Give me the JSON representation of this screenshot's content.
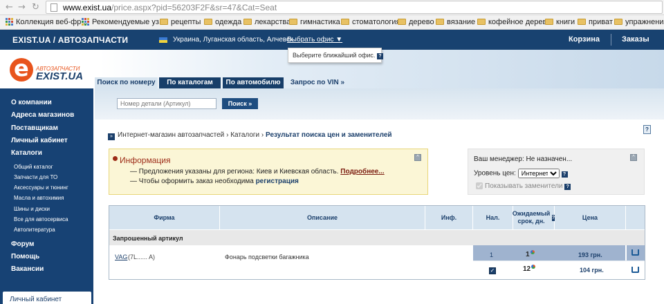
{
  "browser": {
    "url_host": "www.exist.ua",
    "url_path": "/price.aspx?pid=56203F2F&sr=47&Cat=Seat",
    "back": "←",
    "fwd": "→",
    "reload": "↻"
  },
  "bookmarks": [
    "Коллекция веб-фр...",
    "Рекомендуемые уз...",
    "рецепты",
    "одежда",
    "лекарства",
    "гимнастика",
    "стоматология",
    "дерево",
    "вязание",
    "кофейное дерево",
    "книги",
    "приват",
    "упражнения"
  ],
  "topbar": {
    "brand": "EXIST.UA / АВТОЗАПЧАСТИ",
    "region": "Украина, Луганская область, Алчевск",
    "office": "Выбрать офис ▼",
    "cart": "Корзина",
    "orders": "Заказы"
  },
  "tooltip": {
    "text": "Выберите ближайший офис.",
    "help": "?"
  },
  "logo": {
    "sub": "АВТОЗАПЧАСТИ",
    "name": "EXIST.UA"
  },
  "tabs": [
    "Поиск по номеру",
    "По каталогам",
    "По автомобилю",
    "Запрос по VIN »"
  ],
  "search": {
    "placeholder": "Номер детали (Артикул)",
    "button": "Поиск »"
  },
  "sidebar": {
    "main": [
      "О компании",
      "Адреса магазинов",
      "Поставщикам",
      "Личный кабинет",
      "Каталоги"
    ],
    "sub": [
      "Общий каталог",
      "Запчасти для ТО",
      "Аксессуары и тюнинг",
      "Масла и автохимия",
      "Шины и диски",
      "Все для автосервиса",
      "Автолитература"
    ],
    "bottom": [
      "Форум",
      "Помощь",
      "Вакансии"
    ],
    "lk": "Личный кабинет"
  },
  "breadcrumb": {
    "arrow": "»",
    "c1": "Интернет-магазин автозапчастей",
    "sep": "›",
    "c2": "Каталоги",
    "c3": "Результат поиска цен и заменителей"
  },
  "info": {
    "title": "Информация",
    "l1_pre": "— Предложения указаны для региона: Киев и Киевская область.",
    "l1_link": "Подробнее...",
    "l2_pre": "— Чтобы оформить заказ необходима",
    "l2_link": "регистрация",
    "collapse": "^"
  },
  "panel": {
    "manager": "Ваш менеджер: Не назначен...",
    "price_label": "Уровень цен:",
    "price_value": "Интернет",
    "replacements": "Показывать заменители",
    "collapse": "^"
  },
  "table": {
    "headers": [
      "Фирма",
      "Описание",
      "Инф.",
      "Нал.",
      "Ожидаемый срок, дн.",
      "Цена",
      ""
    ],
    "group": "Запрошенный артикул",
    "brand": "VAG",
    "article": "(7L...... A)",
    "description": "Фонарь подсветки багажника",
    "rows": [
      {
        "stock": "1",
        "days": "1",
        "price": "193 грн."
      },
      {
        "stock": "",
        "days": "12",
        "price": "104 грн."
      }
    ]
  }
}
